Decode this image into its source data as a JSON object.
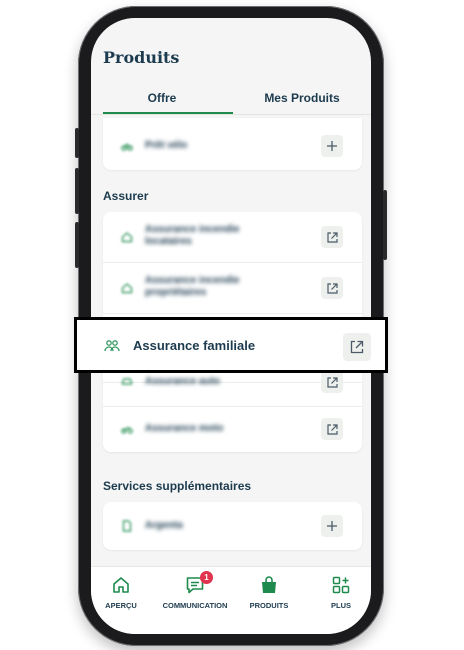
{
  "header": {
    "title": "Produits"
  },
  "tabs": [
    {
      "label": "Offre",
      "active": true
    },
    {
      "label": "Mes Produits",
      "active": false
    }
  ],
  "sections": [
    {
      "label": "",
      "items": [
        {
          "label": "Prêt vélo",
          "blurred": true,
          "action": "add"
        }
      ]
    },
    {
      "label": "Assurer",
      "items": [
        {
          "label": "Assurance incendie locataires",
          "blurred": true,
          "action": "external-link"
        },
        {
          "label": "Assurance incendie propriétaires",
          "blurred": true,
          "action": "external-link"
        },
        {
          "label": "Assurance familiale",
          "blurred": false,
          "action": "external-link",
          "highlighted": true
        },
        {
          "label": "Assurance auto",
          "blurred": true,
          "action": "external-link"
        },
        {
          "label": "Assurance moto",
          "blurred": true,
          "action": "external-link"
        }
      ]
    },
    {
      "label": "Services supplémentaires",
      "items": [
        {
          "label": "Argenta",
          "blurred": true,
          "action": "add"
        }
      ]
    }
  ],
  "bottom_nav": [
    {
      "label": "APERÇU",
      "icon": "home-icon"
    },
    {
      "label": "COMMUNICATION",
      "icon": "chat-icon",
      "badge": "1"
    },
    {
      "label": "PRODUITS",
      "icon": "shopping-bag-icon",
      "active": true
    },
    {
      "label": "PLUS",
      "icon": "grid-plus-icon"
    }
  ],
  "colors": {
    "accent": "#1e8a4d",
    "text": "#1d3b4f",
    "badge": "#e0334d"
  }
}
